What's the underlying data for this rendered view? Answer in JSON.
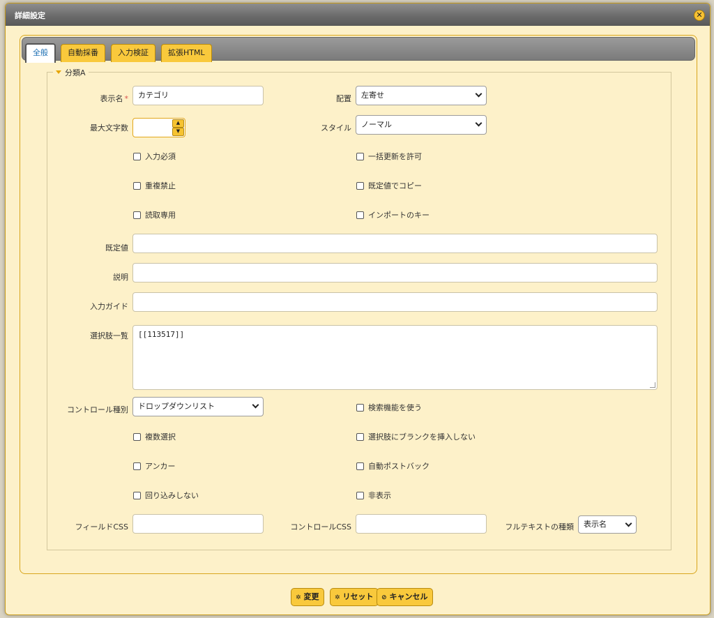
{
  "dialog": {
    "title": "詳細設定",
    "close_icon": "close-icon"
  },
  "tabs": [
    {
      "label": "全般",
      "active": true
    },
    {
      "label": "自動採番",
      "active": false
    },
    {
      "label": "入力検証",
      "active": false
    },
    {
      "label": "拡張HTML",
      "active": false
    }
  ],
  "group": {
    "title": "分類A"
  },
  "fields": {
    "display_name": {
      "label": "表示名",
      "required_mark": "*",
      "value": "カテゴリ"
    },
    "alignment": {
      "label": "配置",
      "value": "左寄せ"
    },
    "max_length": {
      "label": "最大文字数",
      "value": ""
    },
    "style": {
      "label": "スタイル",
      "value": "ノーマル"
    },
    "default_value": {
      "label": "既定値",
      "value": ""
    },
    "description": {
      "label": "説明",
      "value": ""
    },
    "input_guide": {
      "label": "入力ガイド",
      "value": ""
    },
    "choices": {
      "label": "選択肢一覧",
      "value": "[[113517]]"
    },
    "control_type": {
      "label": "コントロール種別",
      "value": "ドロップダウンリスト"
    },
    "field_css": {
      "label": "フィールドCSS",
      "value": ""
    },
    "control_css": {
      "label": "コントロールCSS",
      "value": ""
    },
    "fulltext_type": {
      "label": "フルテキストの種類",
      "value": "表示名"
    }
  },
  "checkboxes": {
    "required": {
      "label": "入力必須",
      "checked": false
    },
    "allow_bulk_update": {
      "label": "一括更新を許可",
      "checked": false
    },
    "no_duplicates": {
      "label": "重複禁止",
      "checked": false
    },
    "copy_by_default": {
      "label": "既定値でコピー",
      "checked": false
    },
    "read_only": {
      "label": "読取専用",
      "checked": false
    },
    "import_key": {
      "label": "インポートのキー",
      "checked": false
    },
    "use_search": {
      "label": "検索機能を使う",
      "checked": false
    },
    "multiple_selection": {
      "label": "複数選択",
      "checked": false
    },
    "no_blank_in_choices": {
      "label": "選択肢にブランクを挿入しない",
      "checked": false
    },
    "anchor": {
      "label": "アンカー",
      "checked": false
    },
    "auto_postback": {
      "label": "自動ポストバック",
      "checked": false
    },
    "no_wrap": {
      "label": "回り込みしない",
      "checked": false
    },
    "hidden": {
      "label": "非表示",
      "checked": false
    }
  },
  "buttons": {
    "change": {
      "label": "変更",
      "icon": "gear-icon"
    },
    "reset": {
      "label": "リセット",
      "icon": "gear-icon"
    },
    "cancel": {
      "label": "キャンセル",
      "icon": "ban-icon"
    }
  },
  "colors": {
    "accent": "#f9c93c",
    "panel_bg": "#fdf1c9",
    "active_tab_text": "#1d6fb3",
    "required_mark": "#d9534f"
  }
}
